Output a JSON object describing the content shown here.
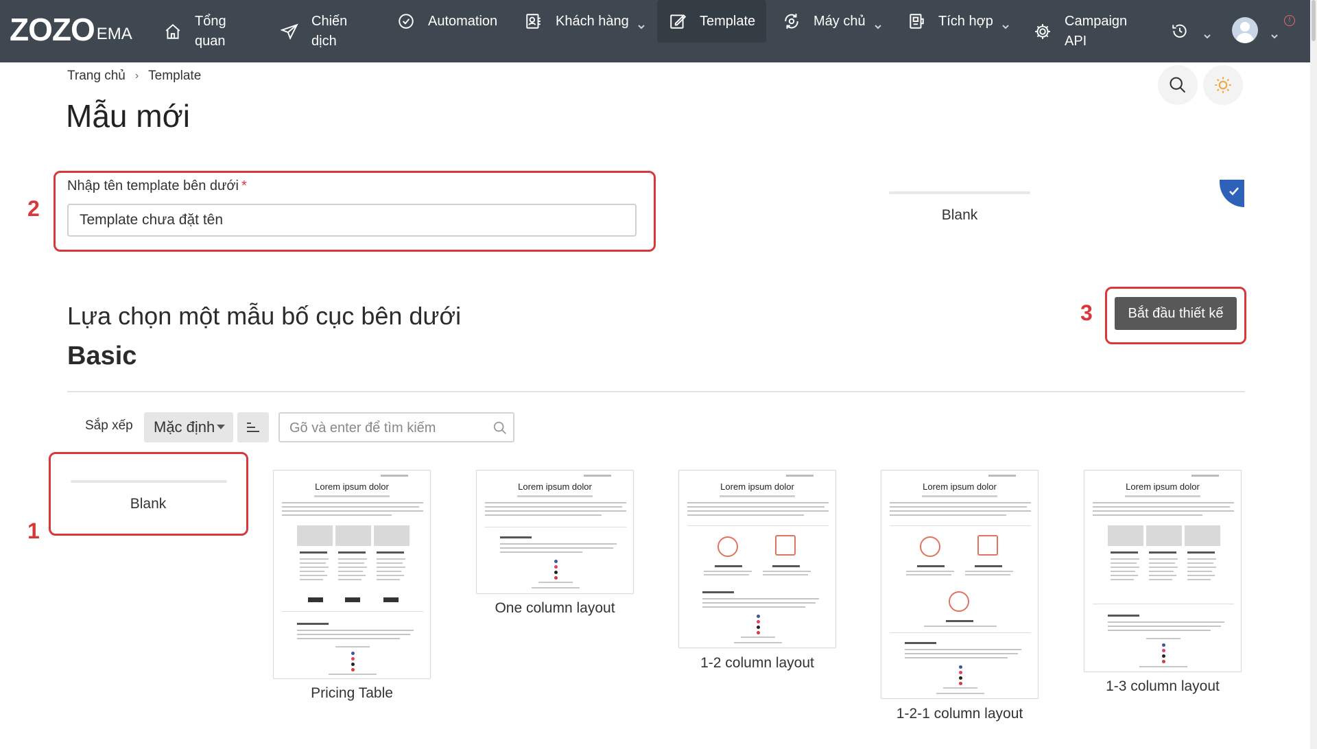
{
  "nav": {
    "logo_main": "ZOZO",
    "logo_sub": "EMA",
    "items": [
      {
        "label_line1": "Tổng",
        "label_line2": "quan",
        "icon": "home-icon"
      },
      {
        "label_line1": "Chiến",
        "label_line2": "dịch",
        "icon": "paper-plane-icon"
      },
      {
        "label_line1": "Automation",
        "label_line2": "",
        "icon": "check-badge-icon"
      },
      {
        "label_line1": "Khách hàng",
        "label_line2": "",
        "icon": "contacts-icon"
      },
      {
        "label_line1": "Template",
        "label_line2": "",
        "icon": "edit-icon"
      },
      {
        "label_line1": "Máy chủ",
        "label_line2": "",
        "icon": "server-sync-icon"
      },
      {
        "label_line1": "Tích hợp",
        "label_line2": "",
        "icon": "integration-icon"
      },
      {
        "label_line1": "Campaign",
        "label_line2": "API",
        "icon": "gear-icon"
      }
    ],
    "alert": "!"
  },
  "breadcrumb": {
    "home": "Trang chủ",
    "separator": "›",
    "current": "Template"
  },
  "page": {
    "title": "Mẫu mới"
  },
  "name_field": {
    "label": "Nhập tên template bên dưới",
    "required_mark": "*",
    "value": "Template chưa đặt tên"
  },
  "selected_preview": {
    "label": "Blank"
  },
  "steps": {
    "one": "1",
    "two": "2",
    "three": "3"
  },
  "layout_section": {
    "title": "Lựa chọn một mẫu bố cục bên dưới",
    "subtitle": "Basic",
    "start_button": "Bắt đầu thiết kế"
  },
  "toolbar": {
    "sort_label": "Sắp xếp",
    "sort_value": "Mặc định",
    "search_placeholder": "Gõ và enter để tìm kiếm"
  },
  "templates": [
    {
      "name": "Blank"
    },
    {
      "name": "Pricing Table",
      "preview_title": "Lorem ipsum dolor"
    },
    {
      "name": "One column layout",
      "preview_title": "Lorem ipsum dolor"
    },
    {
      "name": "1-2 column layout",
      "preview_title": "Lorem ipsum dolor"
    },
    {
      "name": "1-2-1 column layout",
      "preview_title": "Lorem ipsum dolor"
    },
    {
      "name": "1-3 column layout",
      "preview_title": "Lorem ipsum dolor"
    }
  ],
  "colors": {
    "nav_bg": "#3f4850",
    "highlight_red": "#d9383a",
    "primary_button": "#585858",
    "check_blue": "#2d62b8"
  }
}
